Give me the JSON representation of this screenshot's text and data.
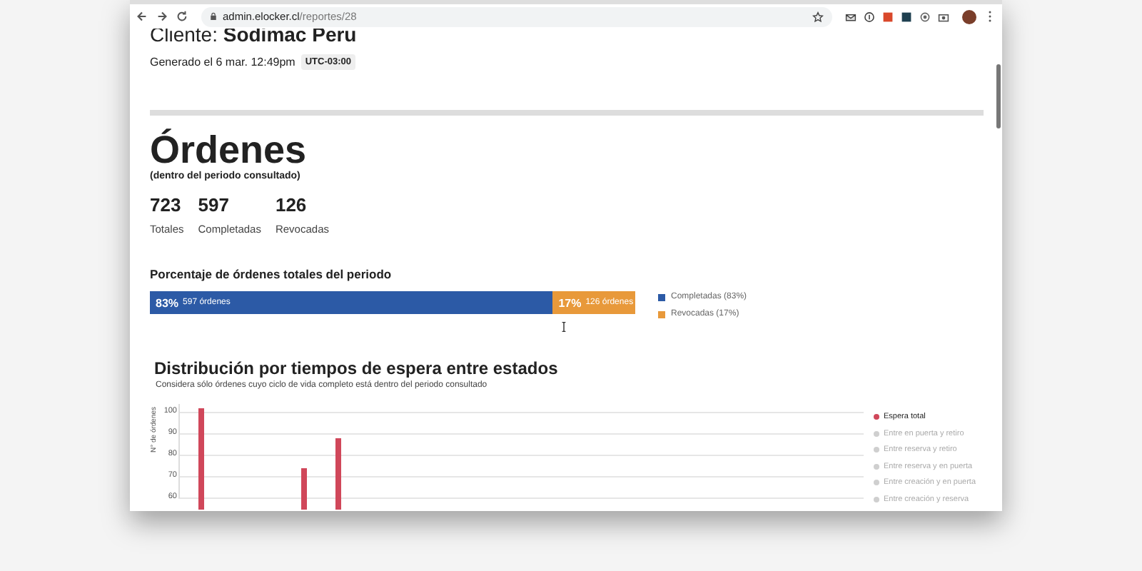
{
  "browser": {
    "url_host": "admin.elocker.cl",
    "url_path": "/reportes/28"
  },
  "header": {
    "client_label": "Cliente:",
    "client_name": "Sodimac Peru",
    "generated": "Generado el 6 mar. 12:49pm",
    "timezone": "UTC-03:00"
  },
  "orders": {
    "title": "Órdenes",
    "subtitle": "(dentro del periodo consultado)",
    "stats": [
      {
        "value": "723",
        "label": "Totales"
      },
      {
        "value": "597",
        "label": "Completadas"
      },
      {
        "value": "126",
        "label": "Revocadas"
      }
    ]
  },
  "percentage": {
    "title": "Porcentaje de órdenes totales del periodo",
    "segments": [
      {
        "level": 0.83,
        "percent": "83%",
        "caption": "597 órdenes",
        "legend": "Completadas (83%)",
        "color": "#2c5aa6"
      },
      {
        "level": 0.17,
        "percent": "17%",
        "caption": "126 órdenes",
        "legend": "Revocadas (17%)",
        "color": "#e8993a"
      }
    ]
  },
  "distribution": {
    "title": "Distribución por tiempos de espera entre estados",
    "subtitle": "Considera sólo órdenes cuyo ciclo de vida completo está dentro del periodo consultado",
    "chart_data": {
      "type": "bar",
      "ylabel": "N° de órdenes",
      "grid": true,
      "ylim": [
        60,
        104
      ],
      "yticks": [
        60,
        70,
        80,
        90,
        100
      ],
      "series": [
        {
          "name": "Espera total",
          "color": "#d0475a",
          "values": [
            null,
            102,
            null,
            null,
            null,
            null,
            null,
            74,
            null,
            88,
            null,
            null,
            null,
            null,
            null,
            null,
            null,
            null,
            null,
            null,
            null,
            null,
            null,
            null,
            null,
            null,
            null,
            null,
            null,
            null,
            null,
            null,
            null,
            null,
            null,
            null,
            null,
            null,
            null,
            null
          ]
        }
      ]
    },
    "legend": [
      {
        "label": "Entre en puerta y retiro",
        "on": false
      },
      {
        "label": "Entre reserva y retiro",
        "on": false
      },
      {
        "label": "Entre reserva y en puerta",
        "on": false
      },
      {
        "label": "Entre creación y en puerta",
        "on": false
      },
      {
        "label": "Entre creación y reserva",
        "on": false
      }
    ]
  }
}
